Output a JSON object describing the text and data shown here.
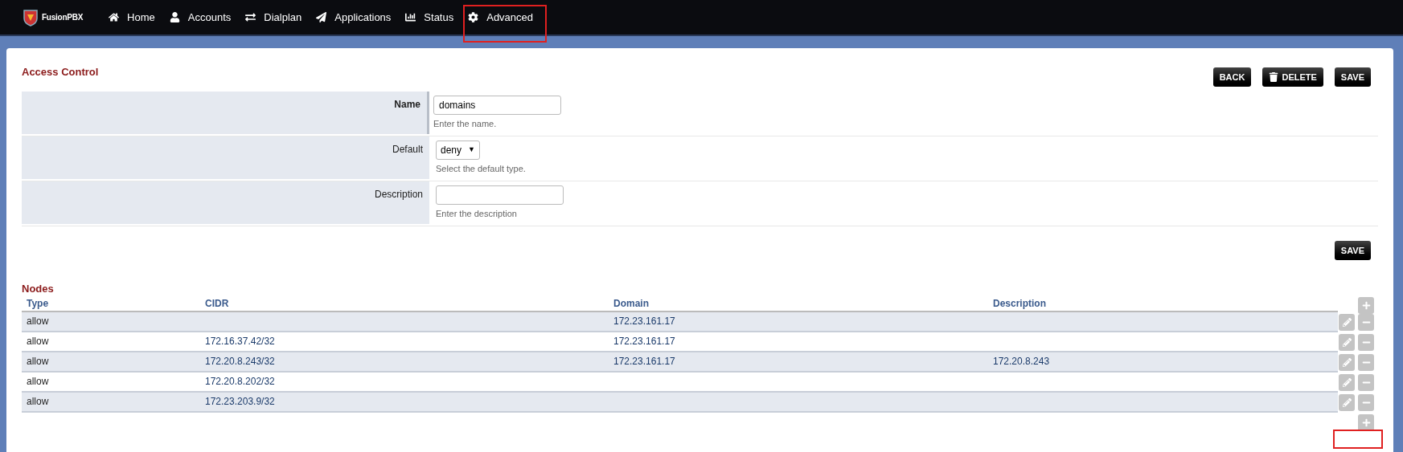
{
  "logo": {
    "text": "FusionPBX"
  },
  "nav": [
    {
      "label": "Home"
    },
    {
      "label": "Accounts"
    },
    {
      "label": "Dialplan"
    },
    {
      "label": "Applications"
    },
    {
      "label": "Status"
    },
    {
      "label": "Advanced"
    }
  ],
  "title": "Access Control",
  "actions": [
    {
      "label": "BACK",
      "kind": "plain"
    },
    {
      "label": "DELETE",
      "kind": "delete"
    },
    {
      "label": "SAVE",
      "kind": "plain"
    }
  ],
  "fields": [
    {
      "label": "Name",
      "required": true,
      "kind": "text",
      "value": "domains",
      "hint": "Enter the name."
    },
    {
      "label": "Default",
      "required": false,
      "kind": "select",
      "value": "deny",
      "caret": "▼",
      "hint": "Select the default type."
    },
    {
      "label": "Description",
      "required": false,
      "kind": "text",
      "hint": "Enter the description"
    }
  ],
  "save_button": "SAVE",
  "nodes": {
    "title": "Nodes",
    "columns": [
      "Type",
      "CIDR",
      "Domain",
      "Description"
    ],
    "rows": [
      [
        "allow",
        "",
        "172.23.161.17",
        ""
      ],
      [
        "allow",
        "172.16.37.42/32",
        "172.23.161.17",
        ""
      ],
      [
        "allow",
        "172.20.8.243/32",
        "172.23.161.17",
        "172.20.8.243"
      ],
      [
        "allow",
        "172.20.8.202/32",
        "",
        ""
      ],
      [
        "allow",
        "172.23.203.9/32",
        "",
        ""
      ]
    ]
  }
}
